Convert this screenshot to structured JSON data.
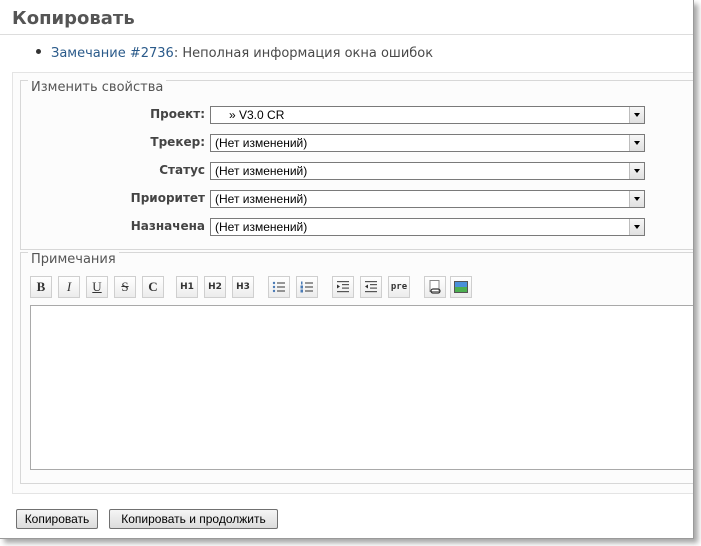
{
  "page": {
    "title": "Копировать"
  },
  "issue": {
    "link": "Замечание #2736",
    "text": ": Неполная информация окна ошибок"
  },
  "properties": {
    "legend": "Изменить свойства",
    "fields": [
      {
        "label": "Проект:",
        "value": "» V3.0 CR"
      },
      {
        "label": "Трекер:",
        "value": "(Нет изменений)"
      },
      {
        "label": "Статус",
        "value": "(Нет изменений)"
      },
      {
        "label": "Приоритет",
        "value": "(Нет изменений)"
      },
      {
        "label": "Назначена",
        "value": "(Нет изменений)"
      }
    ]
  },
  "notes": {
    "legend": "Примечания",
    "toolbar": {
      "bold": "B",
      "italic": "I",
      "underline": "U",
      "strike": "S",
      "code": "C",
      "h1": "H1",
      "h2": "H2",
      "h3": "H3",
      "pre": "pre"
    },
    "value": ""
  },
  "buttons": {
    "copy": "Копировать",
    "copy_continue": "Копировать и продолжить"
  }
}
